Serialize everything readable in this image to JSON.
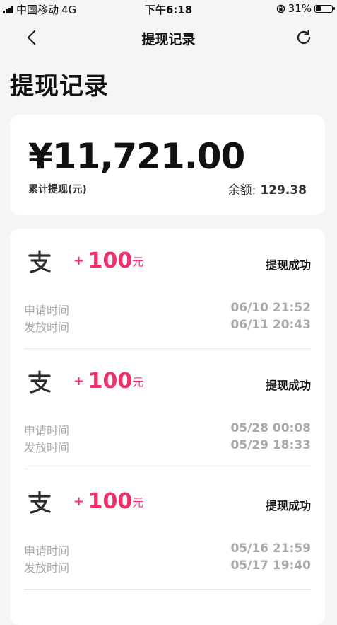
{
  "status_bar": {
    "carrier": "中国移动",
    "network": "4G",
    "time": "下午6:18",
    "battery_percent": "31%",
    "battery_level": 0.31
  },
  "nav": {
    "title": "提现记录",
    "back_icon": "chevron-left-icon",
    "refresh_icon": "refresh-icon"
  },
  "page": {
    "title": "提现记录"
  },
  "summary": {
    "total_amount": "¥11,721.00",
    "total_label": "累计提现(元)",
    "balance_label": "余额:",
    "balance_value": "129.38"
  },
  "records": [
    {
      "icon": "alipay-icon",
      "plus": "+",
      "amount": "100",
      "unit": "元",
      "status": "提现成功",
      "apply_label": "申请时间",
      "apply_time": "06/10 21:52",
      "release_label": "发放时间",
      "release_time": "06/11 20:43"
    },
    {
      "icon": "alipay-icon",
      "plus": "+",
      "amount": "100",
      "unit": "元",
      "status": "提现成功",
      "apply_label": "申请时间",
      "apply_time": "05/28 00:08",
      "release_label": "发放时间",
      "release_time": "05/29 18:33"
    },
    {
      "icon": "alipay-icon",
      "plus": "+",
      "amount": "100",
      "unit": "元",
      "status": "提现成功",
      "apply_label": "申请时间",
      "apply_time": "05/16 21:59",
      "release_label": "发放时间",
      "release_time": "05/17 19:40"
    }
  ],
  "colors": {
    "accent": "#f0306a",
    "background": "#f5f5f5",
    "muted_text": "#a8a8a8"
  }
}
